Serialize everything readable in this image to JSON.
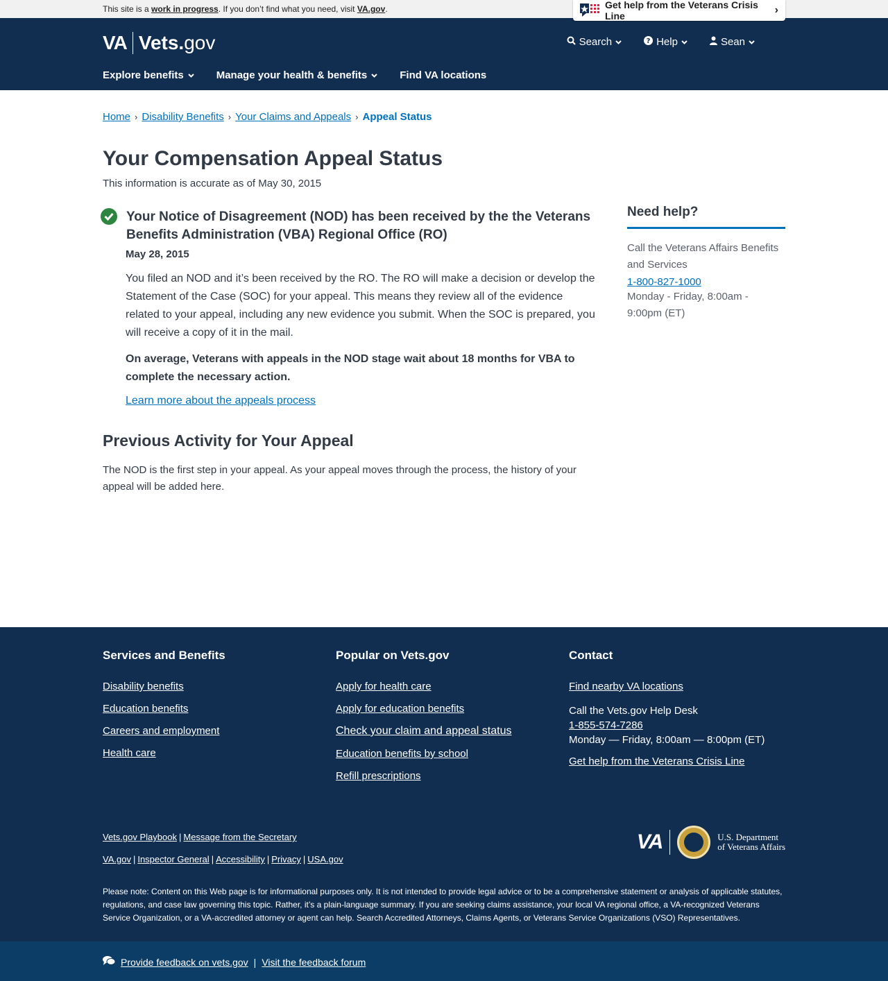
{
  "topbar": {
    "note_prefix": "This site is a ",
    "note_link": "work in progress",
    "note_mid": ". If you don’t find what you need, visit ",
    "note_link2": "VA.gov",
    "note_suffix": ".",
    "crisis_label": "Get help from the Veterans Crisis Line"
  },
  "header": {
    "logo_va": "VA",
    "logo_vets": "Vets.",
    "logo_gov": "gov",
    "util": {
      "search": "Search",
      "help": "Help",
      "user": "Sean"
    },
    "nav": {
      "explore": "Explore benefits",
      "manage": "Manage your health & benefits",
      "find": "Find VA locations"
    }
  },
  "breadcrumb": {
    "home": "Home",
    "disability": "Disability Benefits",
    "claims": "Your Claims and Appeals",
    "current": "Appeal Status"
  },
  "main": {
    "title": "Your Compensation Appeal Status",
    "accurate": "This information is accurate as of May 30, 2015",
    "status": {
      "title": "Your Notice of Disagreement (NOD) has been received by the the Veterans Benefits Administration (VBA) Regional Office (RO)",
      "date": "May 28, 2015",
      "body": "You filed an NOD and it’s been received by the RO. The RO will make a decision or develop the Statement of the Case (SOC) for your appeal. This means they review all of the evidence related to your appeal, including any new evidence you submit. When the SOC is prepared, you will receive a copy of it in the mail.",
      "average": "On average, Veterans with appeals in the NOD stage wait about 18 months for VBA to complete the necessary action.",
      "link": "Learn more about the appeals process"
    },
    "previous": {
      "title": "Previous Activity for Your Appeal",
      "body": "The NOD is the first step in your appeal. As your appeal moves through the process, the history of your appeal will be added here."
    }
  },
  "sidebar": {
    "title": "Need help?",
    "text": "Call the Veterans Affairs Benefits and Services",
    "phone": "1-800-827-1000",
    "hours": "Monday - Friday, 8:00am - 9:00pm (ET)"
  },
  "footer": {
    "services": {
      "title": "Services and Benefits",
      "links": [
        "Disability benefits",
        "Education benefits",
        "Careers and employment",
        "Health care"
      ]
    },
    "popular": {
      "title": "Popular on Vets.gov",
      "links": [
        "Apply for health care",
        "Apply for education benefits",
        "Check your claim and appeal status",
        "Education benefits by school",
        "Refill prescriptions"
      ]
    },
    "contact": {
      "title": "Contact",
      "find": "Find nearby VA locations",
      "helpdesk": "Call the Vets.gov Help Desk",
      "phone": "1-855-574-7286",
      "hours": "Monday — Friday, 8:00am — 8:00pm (ET)",
      "crisis": "Get help from the Veterans Crisis Line"
    },
    "links_row1": [
      "Vets.gov Playbook",
      "Message from the Secretary"
    ],
    "links_row2": [
      "VA.gov",
      "Inspector General",
      "Accessibility",
      "Privacy",
      "USA.gov"
    ],
    "logo_mark": "VA",
    "dept_line1": "U.S. Department",
    "dept_line2": "of Veterans Affairs",
    "disclaimer": "Please note: Content on this Web page is for informational purposes only. It is not intended to provide legal advice or to be a comprehensive statement or analysis of applicable statutes, regulations, and case law governing this topic. Rather, it’s a plain-language summary. If you are seeking claims assistance, your local VA regional office, a VA-recognized Veterans Service Organization, or a VA-accredited attorney or agent can help. Search Accredited Attorneys, Claims Agents, or Veterans Service Organizations (VSO) Representatives."
  },
  "feedback": {
    "provide": "Provide feedback on vets.gov",
    "separator": "|",
    "forum": "Visit the feedback forum"
  },
  "colors": {
    "navy": "#112e51",
    "link_blue": "#0071bb",
    "success_green": "#2e8540",
    "feedback_bar": "#0b3d66"
  },
  "icons": {
    "crisis": "crisis-line-flag-icon",
    "search": "search-icon",
    "help": "question-circle-icon",
    "user": "user-icon",
    "check": "check-circle-icon",
    "feedback": "comments-icon",
    "seal": "va-seal-icon"
  }
}
